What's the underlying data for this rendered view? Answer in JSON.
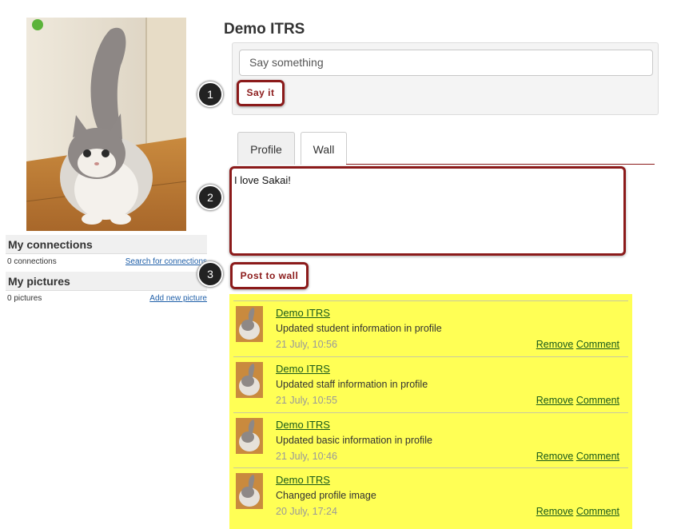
{
  "profile": {
    "name": "Demo ITRS"
  },
  "sidebar": {
    "connections": {
      "heading": "My connections",
      "count": "0 connections",
      "link": "Search for connections"
    },
    "pictures": {
      "heading": "My pictures",
      "count": "0 pictures",
      "link": "Add new picture"
    }
  },
  "status": {
    "placeholder": "Say something",
    "button": "Say it"
  },
  "tabs": [
    {
      "label": "Profile"
    },
    {
      "label": "Wall"
    }
  ],
  "wall": {
    "text": "I love Sakai!",
    "button": "Post to wall"
  },
  "callouts": [
    "1",
    "2",
    "3"
  ],
  "posts": [
    {
      "author": "Demo ITRS",
      "message": "Updated student information in profile",
      "time": "21 July, 10:56",
      "remove": "Remove",
      "comment": "Comment"
    },
    {
      "author": "Demo ITRS",
      "message": "Updated staff information in profile",
      "time": "21 July, 10:55",
      "remove": "Remove",
      "comment": "Comment"
    },
    {
      "author": "Demo ITRS",
      "message": "Updated basic information in profile",
      "time": "21 July, 10:46",
      "remove": "Remove",
      "comment": "Comment"
    },
    {
      "author": "Demo ITRS",
      "message": "Changed profile image",
      "time": "20 July, 17:24",
      "remove": "Remove",
      "comment": "Comment"
    }
  ],
  "colors": {
    "accent": "#8b1a1a",
    "feed_background": "#ffff55",
    "link_green": "#1a5a1a",
    "link_blue": "#1f5fa8"
  }
}
